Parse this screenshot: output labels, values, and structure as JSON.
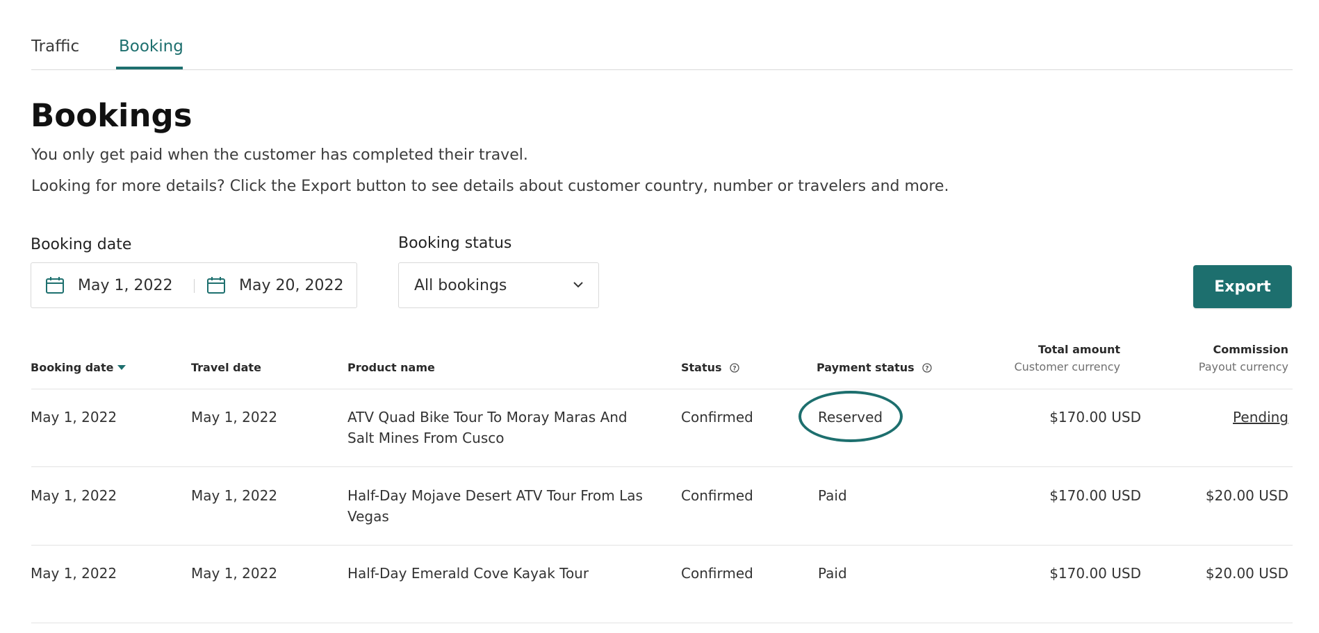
{
  "tabs": [
    {
      "label": "Traffic",
      "active": false
    },
    {
      "label": "Booking",
      "active": true
    }
  ],
  "page": {
    "title": "Bookings",
    "description_1": "You only get paid when the customer has completed their travel.",
    "description_2": "Looking for more details? Click the Export button to see details about customer country, number or travelers and more."
  },
  "filters": {
    "booking_date_label": "Booking date",
    "date_from": "May 1, 2022",
    "date_to": "May 20, 2022",
    "booking_status_label": "Booking status",
    "booking_status_value": "All bookings",
    "export_label": "Export"
  },
  "table": {
    "headers": {
      "booking_date": "Booking date",
      "travel_date": "Travel date",
      "product_name": "Product name",
      "status": "Status",
      "payment_status": "Payment status",
      "total_amount": "Total amount",
      "total_amount_sub": "Customer currency",
      "commission": "Commission",
      "commission_sub": "Payout currency"
    },
    "rows": [
      {
        "booking_date": "May 1, 2022",
        "travel_date": "May 1, 2022",
        "product_name": "ATV Quad Bike Tour To Moray Maras And Salt Mines From Cusco",
        "status": "Confirmed",
        "payment_status": "Reserved",
        "total_amount": "$170.00 USD",
        "commission": "Pending"
      },
      {
        "booking_date": "May 1, 2022",
        "travel_date": "May 1, 2022",
        "product_name": "Half-Day Mojave Desert ATV Tour From Las Vegas",
        "status": "Confirmed",
        "payment_status": "Paid",
        "total_amount": "$170.00 USD",
        "commission": "$20.00 USD"
      },
      {
        "booking_date": "May 1, 2022",
        "travel_date": "May 1, 2022",
        "product_name": "Half-Day Emerald Cove Kayak Tour",
        "status": "Confirmed",
        "payment_status": "Paid",
        "total_amount": "$170.00 USD",
        "commission": "$20.00 USD"
      }
    ]
  },
  "colors": {
    "accent": "#1d6f6e",
    "divider": "#e3e3e3"
  },
  "icons": [
    "calendar-icon",
    "chevron-down-icon",
    "help-icon",
    "sort-desc-icon"
  ]
}
